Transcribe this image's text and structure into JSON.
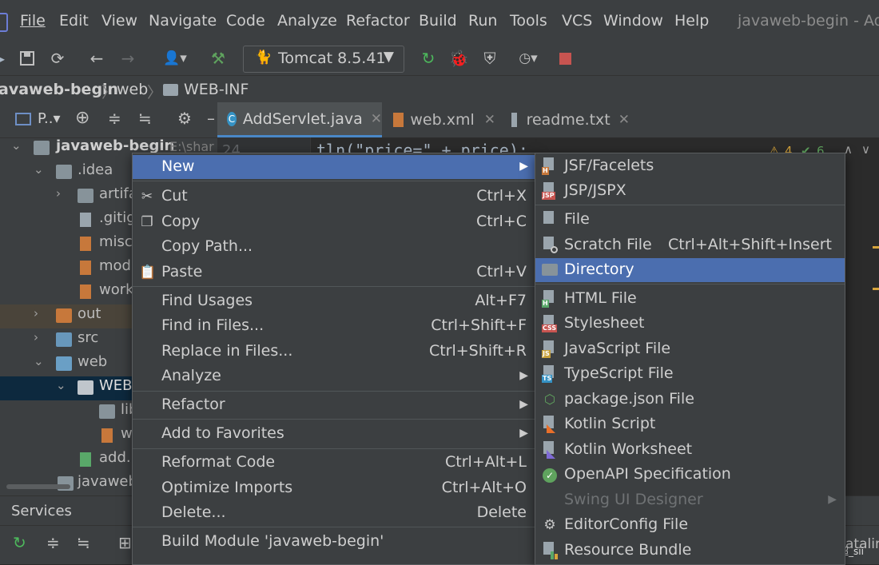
{
  "menubar": {
    "items": [
      "File",
      "Edit",
      "View",
      "Navigate",
      "Code",
      "Analyze",
      "Refactor",
      "Build",
      "Run",
      "Tools",
      "VCS",
      "Window",
      "Help"
    ],
    "window_title": "javaweb-begin - Add"
  },
  "toolbar": {
    "run_config": "Tomcat 8.5.41"
  },
  "breadcrumb": [
    "avaweb-begin",
    "web",
    "WEB-INF"
  ],
  "project_panel": {
    "title": "P..▾",
    "tree": [
      {
        "label": "javaweb-begin",
        "suffix": "E:\\shar"
      },
      {
        "label": ".idea"
      },
      {
        "label": "artifa"
      },
      {
        "label": ".gitig"
      },
      {
        "label": "misc."
      },
      {
        "label": "mod"
      },
      {
        "label": "work"
      },
      {
        "label": "out"
      },
      {
        "label": "src"
      },
      {
        "label": "web"
      },
      {
        "label": "WEB-"
      },
      {
        "label": "lib"
      },
      {
        "label": "w"
      },
      {
        "label": "add.h"
      },
      {
        "label": "javaweb"
      }
    ]
  },
  "editor": {
    "tabs": [
      "AddServlet.java",
      "web.xml",
      "readme.txt"
    ],
    "line_number": "24",
    "code_line": "tln(\"price=\" + price);",
    "warnings": "4",
    "checks": "6"
  },
  "services": {
    "title": "Services",
    "right_text": "atalina"
  },
  "context_menu": {
    "items": [
      {
        "label": "New",
        "shortcut": "",
        "submenu": true,
        "selected": true,
        "icon": ""
      },
      {
        "label": "Cut",
        "shortcut": "Ctrl+X",
        "icon": "scissors-icon"
      },
      {
        "label": "Copy",
        "shortcut": "Ctrl+C",
        "icon": "copy-icon"
      },
      {
        "label": "Copy Path...",
        "shortcut": ""
      },
      {
        "label": "Paste",
        "shortcut": "Ctrl+V",
        "icon": "clipboard-icon"
      },
      {
        "label": "Find Usages",
        "shortcut": "Alt+F7"
      },
      {
        "label": "Find in Files...",
        "shortcut": "Ctrl+Shift+F"
      },
      {
        "label": "Replace in Files...",
        "shortcut": "Ctrl+Shift+R"
      },
      {
        "label": "Analyze",
        "shortcut": "",
        "submenu": true
      },
      {
        "label": "Refactor",
        "shortcut": "",
        "submenu": true
      },
      {
        "label": "Add to Favorites",
        "shortcut": "",
        "submenu": true
      },
      {
        "label": "Reformat Code",
        "shortcut": "Ctrl+Alt+L"
      },
      {
        "label": "Optimize Imports",
        "shortcut": "Ctrl+Alt+O"
      },
      {
        "label": "Delete...",
        "shortcut": "Delete"
      },
      {
        "label": "Build Module 'javaweb-begin'",
        "shortcut": ""
      }
    ]
  },
  "new_submenu": {
    "items": [
      {
        "label": "JSF/Facelets",
        "tag": "H",
        "tagcolor": "#c7783b"
      },
      {
        "label": "JSP/JSPX",
        "tag": "JSP",
        "tagcolor": "#c75450"
      },
      {
        "label": "File"
      },
      {
        "label": "Scratch File",
        "shortcut": "Ctrl+Alt+Shift+Insert"
      },
      {
        "label": "Directory",
        "selected": true
      },
      {
        "label": "HTML File",
        "tag": "H",
        "tagcolor": "#59a869"
      },
      {
        "label": "Stylesheet",
        "tag": "CSS",
        "tagcolor": "#c75450"
      },
      {
        "label": "JavaScript File",
        "tag": "JS",
        "tagcolor": "#c7a03b"
      },
      {
        "label": "TypeScript File",
        "tag": "TS",
        "tagcolor": "#3592c4"
      },
      {
        "label": "package.json File"
      },
      {
        "label": "Kotlin Script"
      },
      {
        "label": "Kotlin Worksheet"
      },
      {
        "label": "OpenAPI Specification"
      },
      {
        "label": "Swing UI Designer",
        "disabled": true
      },
      {
        "label": "EditorConfig File"
      },
      {
        "label": "Resource Bundle"
      }
    ]
  },
  "watermark": "CSDN @超_sii"
}
